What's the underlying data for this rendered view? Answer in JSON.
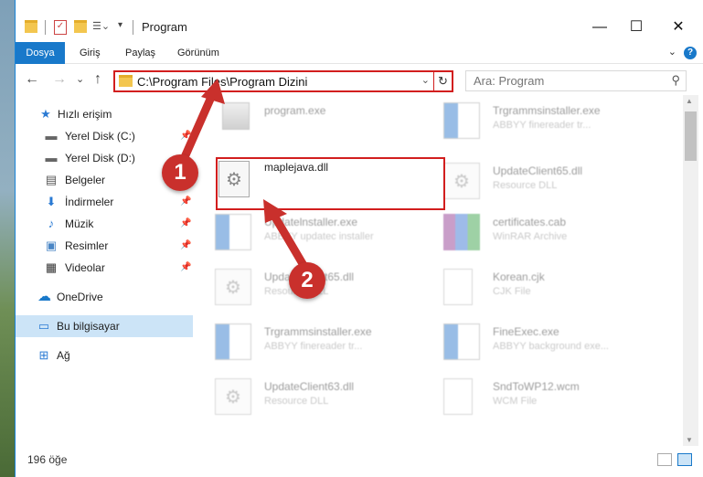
{
  "window": {
    "title": "Program",
    "minimize": "—",
    "maximize": "☐",
    "close": "✕"
  },
  "ribbon": {
    "tabs": [
      "Dosya",
      "Giriş",
      "Paylaş",
      "Görünüm"
    ],
    "help": "?",
    "collapse": "⌄"
  },
  "nav": {
    "back": "←",
    "forward": "→",
    "recent": "⌄",
    "up": "↑",
    "address": "C:\\Program Files\\Program Dizini",
    "address_dd": "⌄",
    "refresh": "↻",
    "search_placeholder": "Ara: Program",
    "search_icon": "⚲"
  },
  "sidebar": {
    "items": [
      {
        "label": "Hızlı erişim",
        "icon": "star-icon",
        "glyph": "★"
      },
      {
        "label": "Yerel Disk (C:)",
        "icon": "drive-icon",
        "glyph": "▬"
      },
      {
        "label": "Yerel Disk (D:)",
        "icon": "drive-icon",
        "glyph": "▬"
      },
      {
        "label": "Belgeler",
        "icon": "document-icon",
        "glyph": "▤"
      },
      {
        "label": "İndirmeler",
        "icon": "download-icon",
        "glyph": "⬇"
      },
      {
        "label": "Müzik",
        "icon": "music-icon",
        "glyph": "♪"
      },
      {
        "label": "Resimler",
        "icon": "picture-icon",
        "glyph": "▣"
      },
      {
        "label": "Videolar",
        "icon": "video-icon",
        "glyph": "▦"
      },
      {
        "label": "OneDrive",
        "icon": "cloud-icon",
        "glyph": "☁"
      },
      {
        "label": "Bu bilgisayar",
        "icon": "computer-icon",
        "glyph": "▭"
      },
      {
        "label": "Ağ",
        "icon": "network-icon",
        "glyph": "⊞"
      }
    ],
    "pin_glyph": "📌"
  },
  "files": [
    {
      "name": "program.exe",
      "type": "",
      "icon": "exe-icon"
    },
    {
      "name": "Trgrammsinstaller.exe",
      "type": "ABBYY finereader tr...",
      "icon": "installer-icon"
    },
    {
      "name": "maplejava.dll",
      "type": "",
      "icon": "dll-gear-icon"
    },
    {
      "name": "UpdateClient65.dll",
      "type": "Resource DLL",
      "icon": "dll-gear-icon"
    },
    {
      "name": "Updatelnstaller.exe",
      "type": "ABBYY updatec installer",
      "icon": "installer-icon"
    },
    {
      "name": "certificates.cab",
      "type": "WinRAR Archive",
      "icon": "archive-icon"
    },
    {
      "name": "UpdateClient65.dll",
      "type": "Resource DLL",
      "icon": "dll-gear-icon"
    },
    {
      "name": "Korean.cjk",
      "type": "CJK File",
      "icon": "blank-file-icon"
    },
    {
      "name": "Trgrammsinstaller.exe",
      "type": "ABBYY finereader tr...",
      "icon": "installer-icon"
    },
    {
      "name": "FineExec.exe",
      "type": "ABBYY background exe...",
      "icon": "installer-icon"
    },
    {
      "name": "UpdateClient63.dll",
      "type": "Resource DLL",
      "icon": "dll-gear-icon"
    },
    {
      "name": "SndToWP12.wcm",
      "type": "WCM File",
      "icon": "blank-file-icon"
    }
  ],
  "annotations": {
    "step1": "1",
    "step2": "2"
  },
  "status": {
    "count": "196 öğe"
  },
  "colors": {
    "accent": "#1979ca",
    "highlight": "#d21e1e",
    "bubble": "#c9302c"
  }
}
